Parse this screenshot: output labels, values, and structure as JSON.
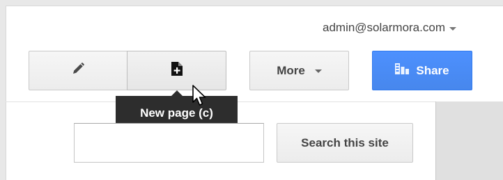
{
  "header": {
    "account_email": "admin@solarmora.com"
  },
  "toolbar": {
    "edit_icon": "pencil-icon",
    "new_page_icon": "new-page-icon",
    "more_label": "More",
    "share_label": "Share",
    "share_icon": "grid-icon",
    "accent_color": "#4d90fe"
  },
  "tooltip": {
    "text": "New page (c)"
  },
  "search": {
    "input_value": "",
    "button_label": "Search this site"
  }
}
